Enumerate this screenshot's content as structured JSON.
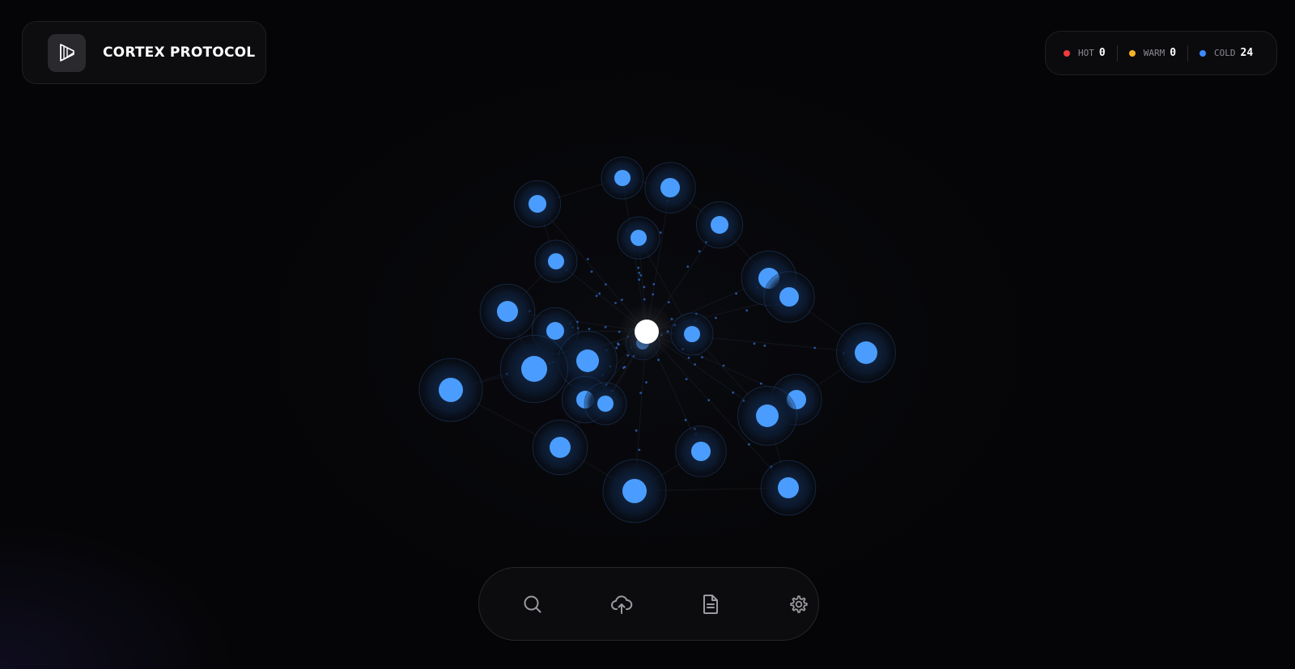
{
  "brand": {
    "title": "CORTEX PROTOCOL",
    "logo_icon": "layered-cube-logo-icon"
  },
  "legend": {
    "items": [
      {
        "label": "HOT",
        "count": "0",
        "color": "#ef3b3b"
      },
      {
        "label": "WARM",
        "count": "0",
        "color": "#f5b324"
      },
      {
        "label": "COLD",
        "count": "24",
        "color": "#3d8bff"
      }
    ]
  },
  "graph": {
    "center_node_color": "#ffffff",
    "node_color": "#4a9dff",
    "cold_node_count": 24
  },
  "toolbar": {
    "items": [
      {
        "name": "search",
        "icon": "search-icon"
      },
      {
        "name": "upload",
        "icon": "cloud-upload-icon"
      },
      {
        "name": "documents",
        "icon": "document-icon"
      },
      {
        "name": "settings",
        "icon": "gear-icon"
      }
    ]
  },
  "colors": {
    "background": "#050507",
    "accent": "#4a9dff",
    "hot": "#ef3b3b",
    "warm": "#f5b324",
    "cold": "#3d8bff"
  }
}
